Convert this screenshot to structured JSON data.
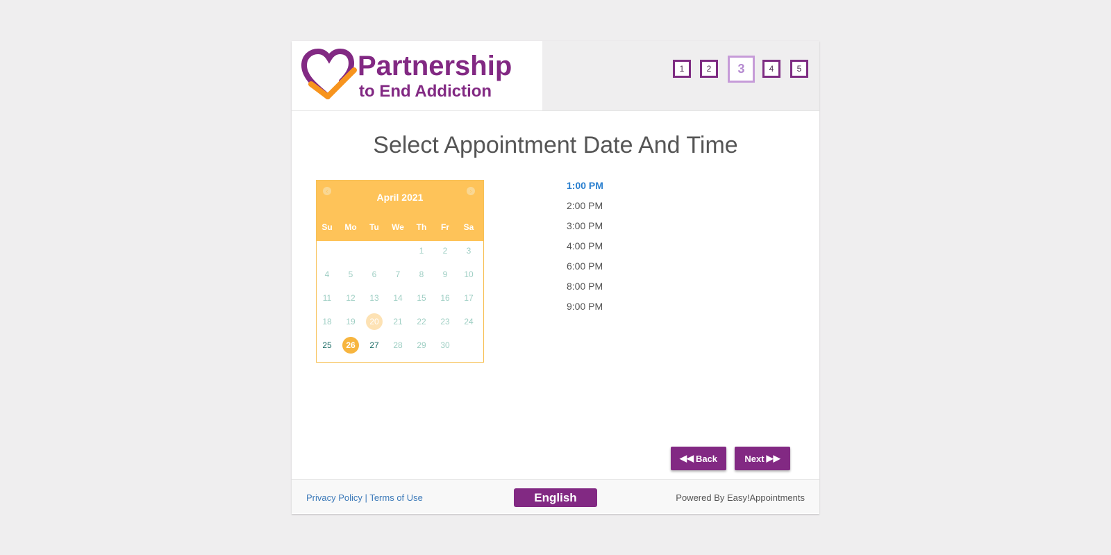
{
  "brand": {
    "line1": "Partnership",
    "line2": "to End Addiction",
    "primary_color": "#822983",
    "accent_color": "#f7941e"
  },
  "steps": [
    {
      "label": "1",
      "active": false
    },
    {
      "label": "2",
      "active": false
    },
    {
      "label": "3",
      "active": true
    },
    {
      "label": "4",
      "active": false
    },
    {
      "label": "5",
      "active": false
    }
  ],
  "page_title": "Select Appointment Date And Time",
  "calendar": {
    "month_label": "April 2021",
    "prev_icon": "chevron-left-icon",
    "next_icon": "chevron-right-icon",
    "weekdays": [
      "Su",
      "Mo",
      "Tu",
      "We",
      "Th",
      "Fr",
      "Sa"
    ],
    "days": [
      "1",
      "2",
      "3",
      "4",
      "5",
      "6",
      "7",
      "8",
      "9",
      "10",
      "11",
      "12",
      "13",
      "14",
      "15",
      "16",
      "17",
      "18",
      "19",
      "20",
      "21",
      "22",
      "23",
      "24",
      "25",
      "26",
      "27",
      "28",
      "29",
      "30"
    ],
    "available_days": [
      "25",
      "26",
      "27"
    ],
    "today": "20",
    "selected_day": "26",
    "header_color": "#fec359"
  },
  "time_slots": [
    "1:00 PM",
    "2:00 PM",
    "3:00 PM",
    "4:00 PM",
    "6:00 PM",
    "8:00 PM",
    "9:00 PM"
  ],
  "selected_time": "1:00 PM",
  "buttons": {
    "back_label": "Back",
    "next_label": "Next"
  },
  "footer": {
    "privacy_label": "Privacy Policy",
    "separator": "|",
    "terms_label": "Terms of Use",
    "language_label": "English",
    "powered_label": "Powered By Easy!Appointments"
  }
}
